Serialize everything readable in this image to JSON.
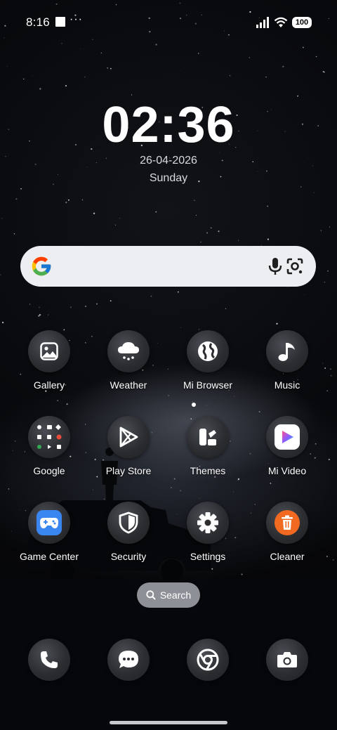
{
  "status_bar": {
    "time": "8:16",
    "overflow": "···",
    "battery": "100",
    "icons": [
      "signal-icon",
      "wifi-icon",
      "battery-icon"
    ]
  },
  "lock_clock": {
    "time": "02:36",
    "date": "26-04-2026",
    "weekday": "Sunday"
  },
  "search_widget": {
    "icons": [
      "google-logo-icon",
      "microphone-icon",
      "lens-icon"
    ]
  },
  "apps": [
    {
      "label": "Gallery",
      "icon": "gallery-icon"
    },
    {
      "label": "Weather",
      "icon": "weather-icon"
    },
    {
      "label": "Mi Browser",
      "icon": "browser-globe-icon"
    },
    {
      "label": "Music",
      "icon": "music-note-icon"
    },
    {
      "label": "Google",
      "icon": "google-folder-icon"
    },
    {
      "label": "Play Store",
      "icon": "play-store-icon"
    },
    {
      "label": "Themes",
      "icon": "themes-icon"
    },
    {
      "label": "Mi Video",
      "icon": "mi-video-icon"
    },
    {
      "label": "Game Center",
      "icon": "game-controller-icon"
    },
    {
      "label": "Security",
      "icon": "shield-icon"
    },
    {
      "label": "Settings",
      "icon": "gear-icon"
    },
    {
      "label": "Cleaner",
      "icon": "trash-icon"
    }
  ],
  "app_drawer_search": {
    "label": "Search",
    "icon": "search-icon"
  },
  "dock": [
    {
      "icon": "phone-icon"
    },
    {
      "icon": "messages-icon"
    },
    {
      "icon": "chrome-icon"
    },
    {
      "icon": "camera-icon"
    }
  ],
  "colors": {
    "game_center": "#3a86f0",
    "cleaner": "#f26a21",
    "mi_video": "#ffffff"
  }
}
